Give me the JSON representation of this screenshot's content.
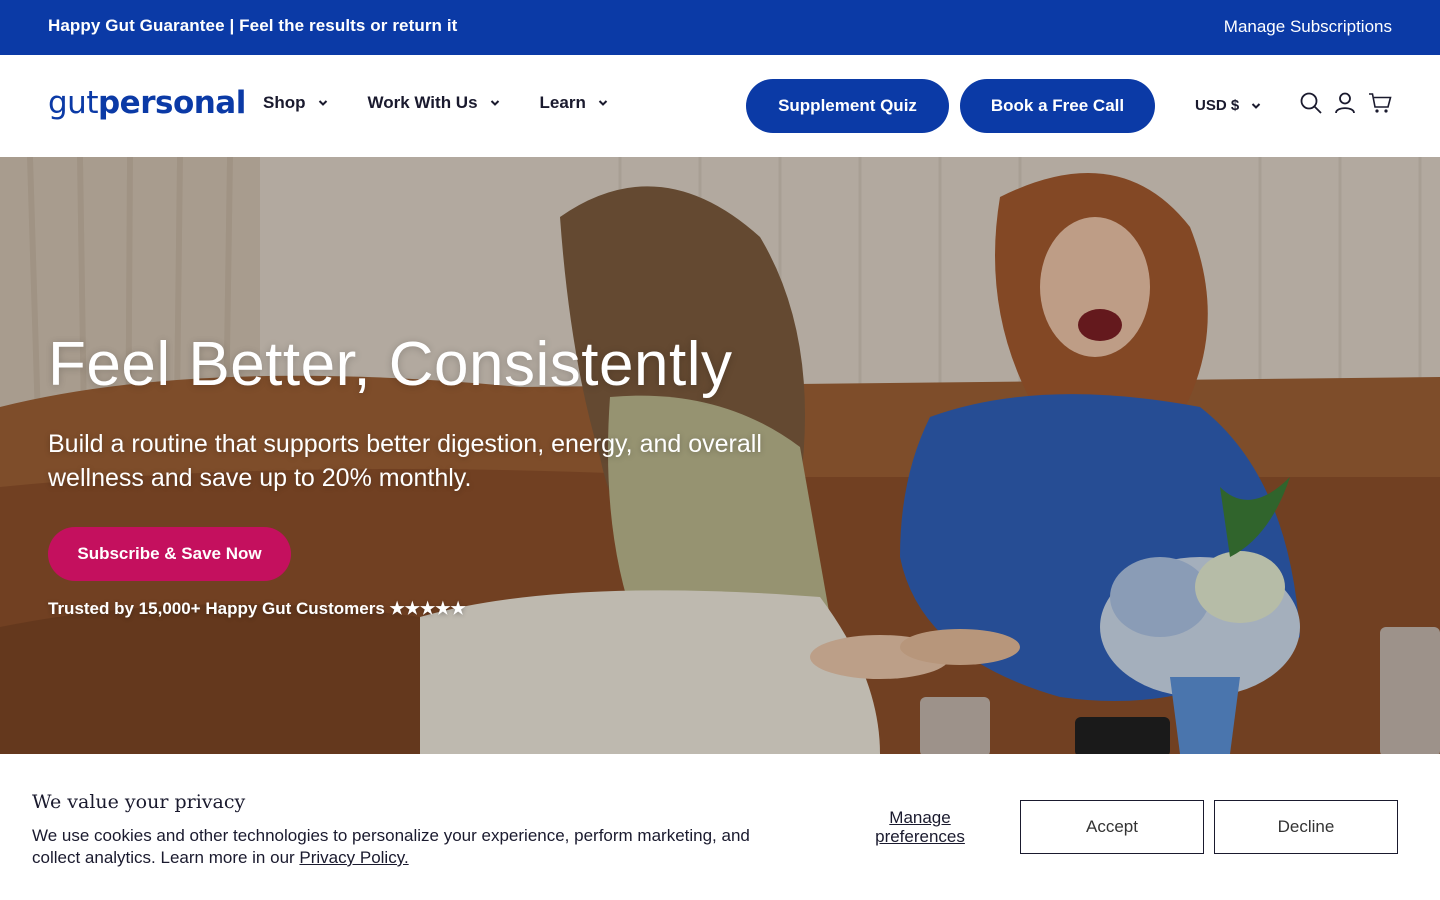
{
  "announcement": {
    "guarantee_text": "Happy Gut Guarantee | Feel the results or return it",
    "manage_subscriptions": "Manage Subscriptions",
    "bg_color": "#0b3aa6"
  },
  "header": {
    "logo": {
      "part1": "gut",
      "part2": "personal"
    },
    "nav": [
      {
        "label": "Shop",
        "icon": "chevron-down-icon"
      },
      {
        "label": "Work With Us",
        "icon": "chevron-down-icon"
      },
      {
        "label": "Learn",
        "icon": "chevron-down-icon"
      }
    ],
    "quiz_button": "Supplement Quiz",
    "call_button": "Book a Free Call",
    "currency": "USD $",
    "icons": [
      "search-icon",
      "account-icon",
      "cart-icon"
    ],
    "accent_color": "#0b3aa6"
  },
  "hero": {
    "title": "Feel Better, Consistently",
    "subtitle": "Build a routine that supports better digestion, energy, and overall wellness and save up to 20% monthly.",
    "cta": "Subscribe & Save Now",
    "cta_color": "#c4105e",
    "trusted": "Trusted by 15,000+ Happy Gut Customers ★★★★★"
  },
  "cookie": {
    "title": "We value your privacy",
    "body": "We use cookies and other technologies to personalize your experience, perform marketing, and collect analytics. Learn more in our ",
    "privacy_link": "Privacy Policy.",
    "manage": "Manage preferences",
    "accept": "Accept",
    "decline": "Decline"
  }
}
